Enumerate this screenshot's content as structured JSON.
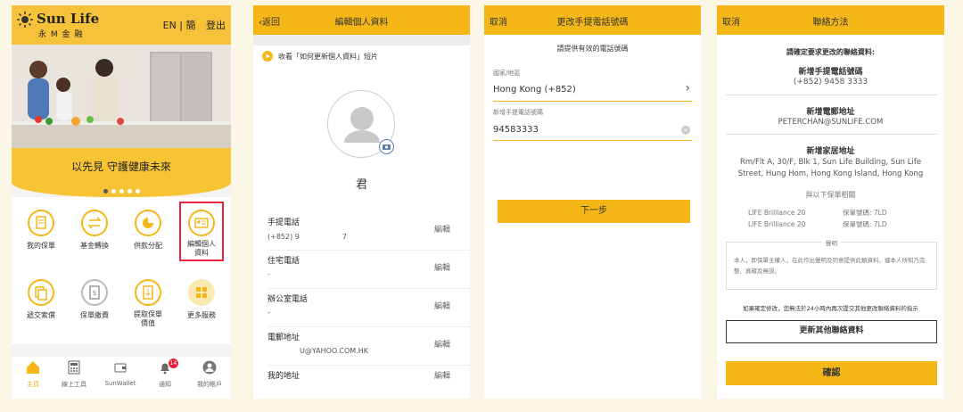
{
  "colors": {
    "brand_gold": "#f5b718",
    "highlight": "#e8243c",
    "bg": "#fbf6e6"
  },
  "home": {
    "logo_en": "Sun Life",
    "logo_zh": "永 M 金 融",
    "lang_en": "EN",
    "lang_sep": "|",
    "lang_zh": "簡",
    "logout": "登出",
    "banner_text": "以先見 守護健康未來",
    "grid": [
      {
        "label": "我的保單",
        "icon": "policy-icon"
      },
      {
        "label": "基金轉換",
        "icon": "swap-icon"
      },
      {
        "label": "供款分配",
        "icon": "pie-icon"
      },
      {
        "label": "編輯個人\n資料",
        "icon": "profile-card-icon"
      },
      {
        "label": "遞交索償",
        "icon": "claim-icon"
      },
      {
        "label": "保單繳費",
        "icon": "payment-icon"
      },
      {
        "label": "提取保單\n價值",
        "icon": "withdraw-icon"
      },
      {
        "label": "更多服務",
        "icon": "grid-icon"
      }
    ],
    "tabs": [
      {
        "label": "主頁",
        "icon": "home-icon"
      },
      {
        "label": "線上工具",
        "icon": "calculator-icon"
      },
      {
        "label": "SunWallet",
        "icon": "wallet-icon"
      },
      {
        "label": "通知",
        "icon": "bell-icon",
        "badge": "14"
      },
      {
        "label": "我的帳戶",
        "icon": "user-icon"
      }
    ]
  },
  "edit": {
    "back": "返回",
    "title": "編輯個人資料",
    "video_link": "收看「如何更新個人資料」短片",
    "name": "君",
    "fields": [
      {
        "label": "手提電話",
        "value": "(+852) 9　　　　　　7",
        "action": "編輯"
      },
      {
        "label": "住宅電話",
        "value": "-",
        "action": "編輯"
      },
      {
        "label": "辦公室電話",
        "value": "-",
        "action": "編輯"
      },
      {
        "label": "電郵地址",
        "value": "U@YAHOO.COM.HK",
        "action": "編輯"
      },
      {
        "label": "我的地址",
        "value": "",
        "action": "編輯"
      }
    ]
  },
  "phone_change": {
    "cancel": "取消",
    "title": "更改手提電話號碼",
    "prompt": "請提供有效的電話號碼",
    "country_label": "國家/地區",
    "country_value": "Hong Kong (+852)",
    "mobile_label": "新增手提電話號碼",
    "mobile_value": "94583333",
    "next": "下一步"
  },
  "contact": {
    "cancel": "取消",
    "title": "聯絡方法",
    "confirm_prompt": "請確定要求更改的聯絡資料:",
    "new_mobile_label": "新增手提電話號碼",
    "new_mobile_value": "(+852) 9458 3333",
    "new_email_label": "新增電郵地址",
    "new_email_value": "PETERCHAN@SUNLIFE.COM",
    "new_address_label": "新增家居地址",
    "new_address_value": "Rm/Flt A, 30/F, Blk 1, Sun Life Building, Sun Life Street, Hung Hom, Hong Kong Island, Hong Kong",
    "related_title": "與以下保單相關",
    "policies": [
      {
        "name": "LIFE Brilliance 20",
        "number": "保單號碼: 7LD"
      },
      {
        "name": "LIFE Brilliance 20",
        "number": "保單號碼: 7LD"
      }
    ],
    "declaration_title": "聲明",
    "declaration_text": "本人，即保單主權人，在此作出聲明及同意提供此類資料，據本人所知乃完整、真確及無誤。",
    "notice": "如果確定修改，您無法於24小時內再次提交其他更改聯絡資料的指示",
    "update_other": "更新其他聯絡資料",
    "confirm": "確認"
  }
}
